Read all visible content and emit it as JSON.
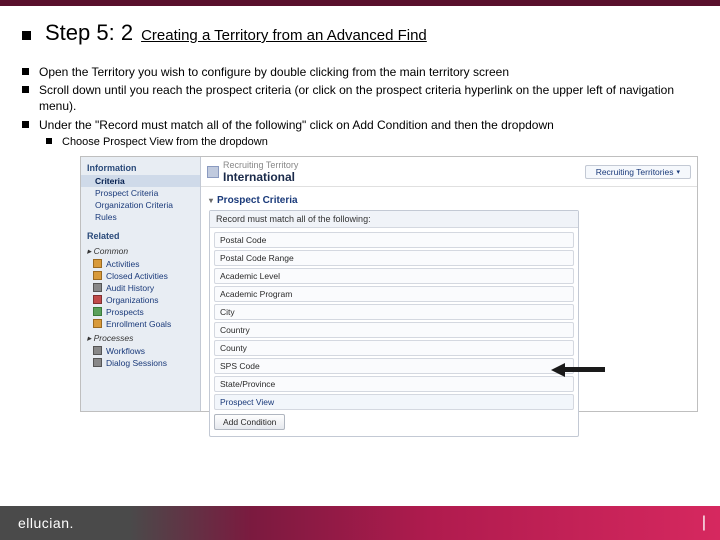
{
  "title": {
    "step": "Step 5: 2",
    "subtitle": "Creating a Territory from an Advanced Find"
  },
  "bullets": {
    "items": [
      "Open the Territory you wish to configure by double clicking from the main territory screen",
      "Scroll down until you reach the prospect criteria (or click on the prospect criteria hyperlink on the upper left of navigation menu).",
      "Under the \"Record must match all of the following\" click on Add Condition and then the dropdown"
    ],
    "sub": "Choose Prospect View from the dropdown"
  },
  "screenshot": {
    "nav": {
      "info_hdr": "Information",
      "info_items": [
        "Criteria",
        "Prospect Criteria",
        "Organization Criteria",
        "Rules"
      ],
      "related_hdr": "Related",
      "common_hdr": "Common",
      "common_items": [
        "Activities",
        "Closed Activities",
        "Audit History",
        "Organizations",
        "Prospects",
        "Enrollment Goals"
      ],
      "proc_hdr": "Processes",
      "proc_items": [
        "Workflows",
        "Dialog Sessions"
      ]
    },
    "main": {
      "type_label": "Recruiting Territory",
      "name": "International",
      "right_button": "Recruiting Territories",
      "section_hdr": "Prospect Criteria",
      "match_label": "Record must match all of the following:",
      "fields": [
        "Postal Code",
        "Postal Code Range",
        "Academic Level",
        "Academic Program",
        "City",
        "Country",
        "County",
        "SPS Code",
        "State/Province",
        "Prospect View"
      ],
      "add_btn": "Add Condition"
    }
  },
  "footer": {
    "brand": "ellucian."
  }
}
